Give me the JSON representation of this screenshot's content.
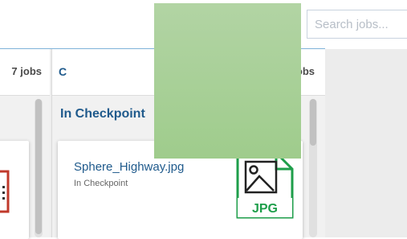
{
  "search": {
    "placeholder": "Search jobs..."
  },
  "columns": [
    {
      "count_label": "7 jobs",
      "title": ""
    },
    {
      "count_label": "obs",
      "title": "C",
      "status_heading": "In Checkpoint"
    }
  ],
  "card": {
    "filename": "Sphere_Highway.jpg",
    "status": "In Checkpoint",
    "filetype": "JPG"
  },
  "colors": {
    "accent": "#1f5a8c",
    "jpg_green": "#1e9e4a",
    "red_icon": "#c0392b",
    "overlay": "#a6cf94"
  },
  "icons": [
    "image-file-icon",
    "red-file-icon"
  ]
}
